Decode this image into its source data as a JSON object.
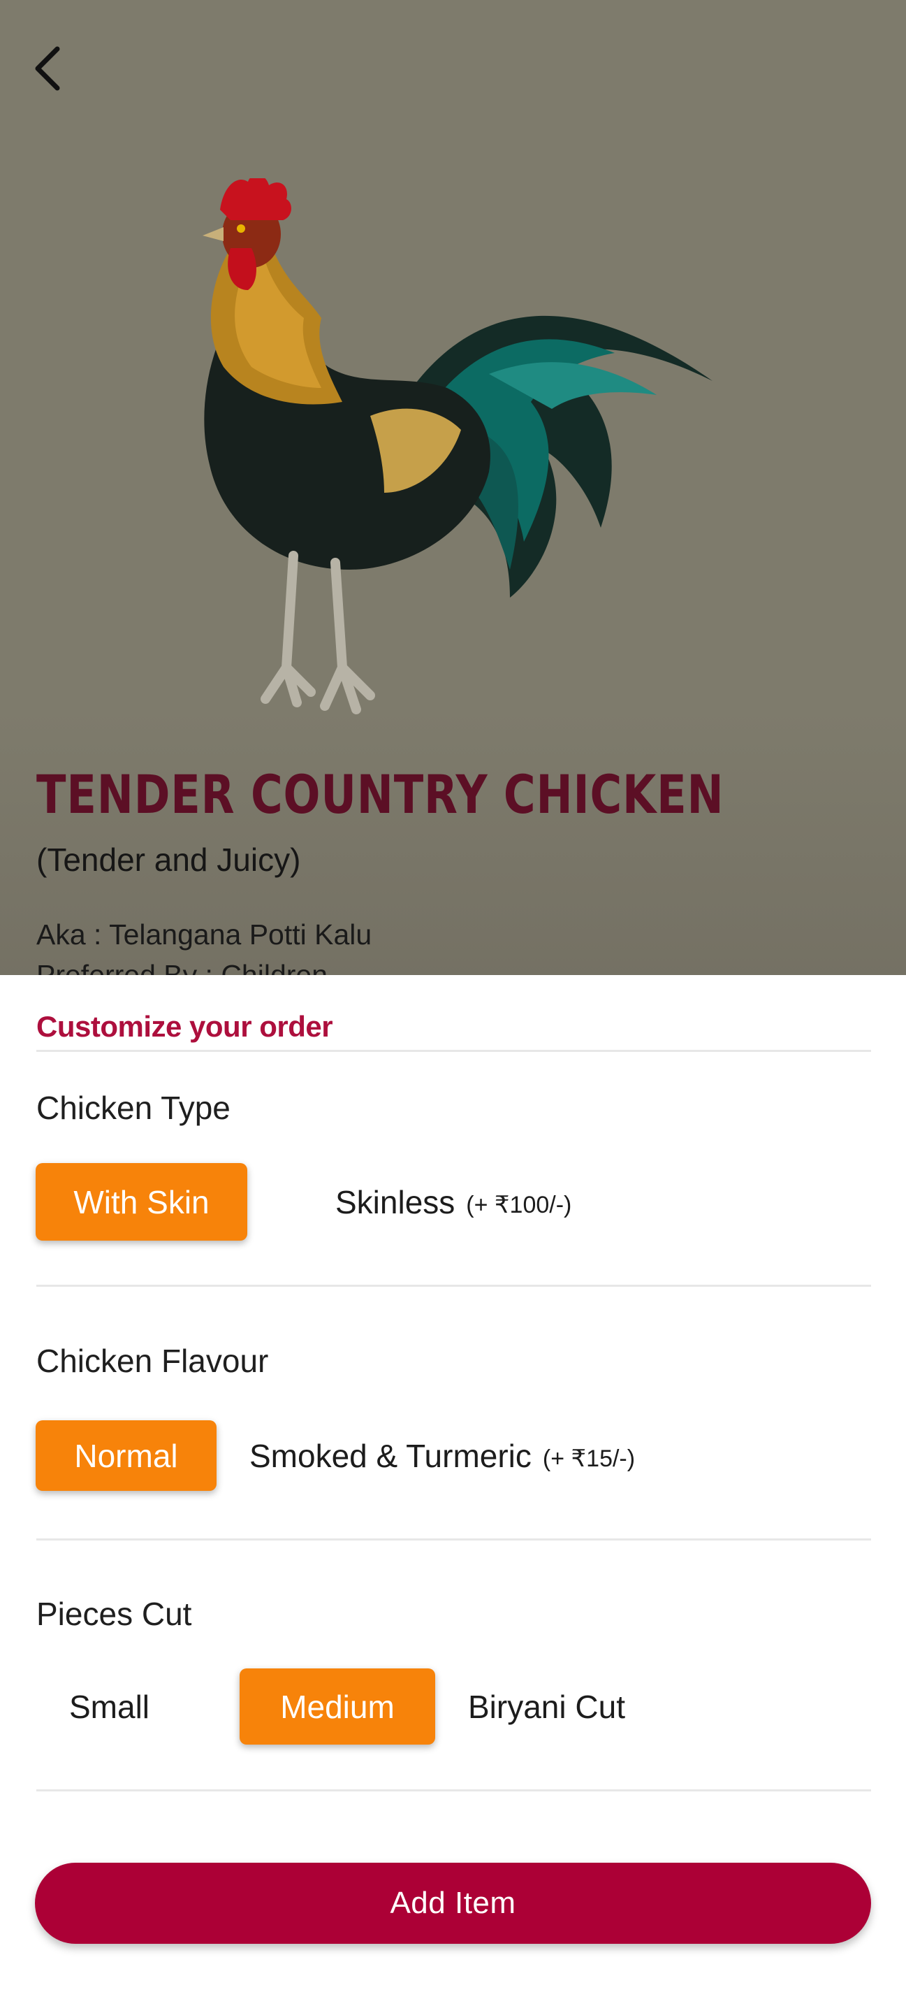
{
  "colors": {
    "accent": "#f7830a",
    "brand": "#ac0036",
    "title": "#5c0f25",
    "hero_bg": "#7e7b6c"
  },
  "icons": {
    "back": "chevron-left-icon",
    "product_image": "rooster-image"
  },
  "product": {
    "title": "TENDER COUNTRY CHICKEN",
    "subtitle": "(Tender and Juicy)",
    "aka": "Aka : Telangana Potti Kalu",
    "preferred": "Preferred By : Children"
  },
  "customize": {
    "title": "Customize your order",
    "sections": [
      {
        "title": "Chicken Type",
        "options": [
          {
            "label": "With Skin",
            "extra": "",
            "selected": true
          },
          {
            "label": "Skinless",
            "extra": "(+ ₹100/-)",
            "selected": false
          }
        ]
      },
      {
        "title": "Chicken Flavour",
        "options": [
          {
            "label": "Normal",
            "extra": "",
            "selected": true
          },
          {
            "label": "Smoked & Turmeric",
            "extra": "(+ ₹15/-)",
            "selected": false
          }
        ]
      },
      {
        "title": "Pieces Cut",
        "options": [
          {
            "label": "Small",
            "extra": "",
            "selected": false
          },
          {
            "label": "Medium",
            "extra": "",
            "selected": true
          },
          {
            "label": "Biryani Cut",
            "extra": "",
            "selected": false
          }
        ]
      }
    ]
  },
  "add_button": {
    "label": "Add Item"
  }
}
